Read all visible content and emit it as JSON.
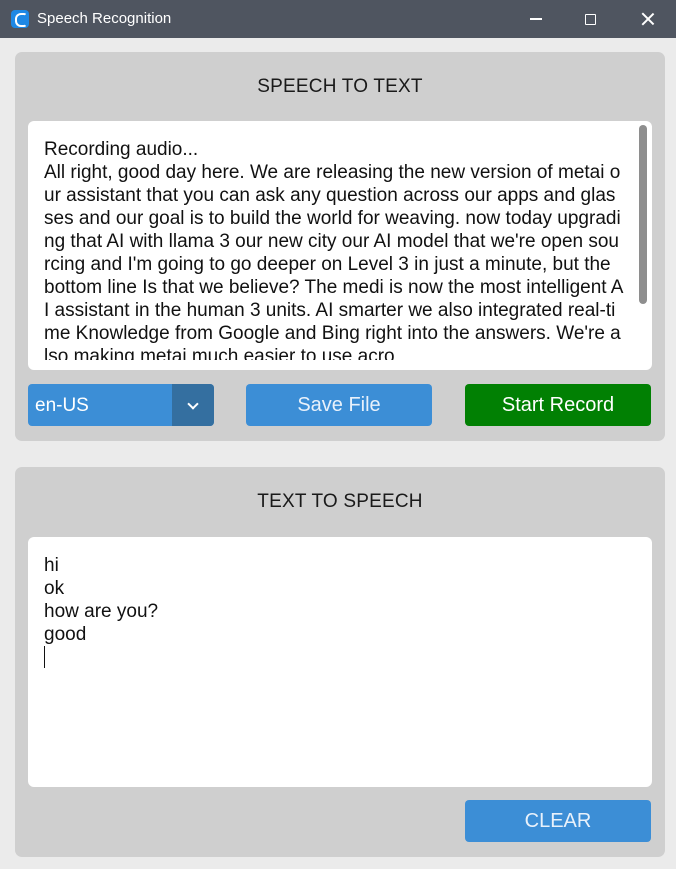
{
  "window": {
    "title": "Speech Recognition"
  },
  "speech_to_text": {
    "title": "SPEECH TO TEXT",
    "transcript": "Recording audio...\nAll right, good day here. We are releasing the new version of metai our assistant that you can ask any question across our apps and glasses and our goal is to build the world for weaving. now today upgrading that AI with llama 3 our new city our AI model that we're open sourcing and I'm going to go deeper on Level 3 in just a minute, but the bottom line Is that we believe? The medi is now the most intelligent AI assistant in the human 3 units. AI smarter we also integrated real-time Knowledge from Google and Bing right into the answers. We're also making metai much easier to use acro",
    "language": "en-US",
    "save_label": "Save File",
    "record_label": "Start Record"
  },
  "text_to_speech": {
    "title": "TEXT TO SPEECH",
    "input_text": "hi\nok\nhow are you?\ngood\n",
    "clear_label": "CLEAR"
  },
  "colors": {
    "titlebar": "#4f5560",
    "frame": "#cfcfcf",
    "accent_blue": "#3c8ed6",
    "dropdown_arrow": "#346fa0",
    "record_green": "#018003"
  }
}
